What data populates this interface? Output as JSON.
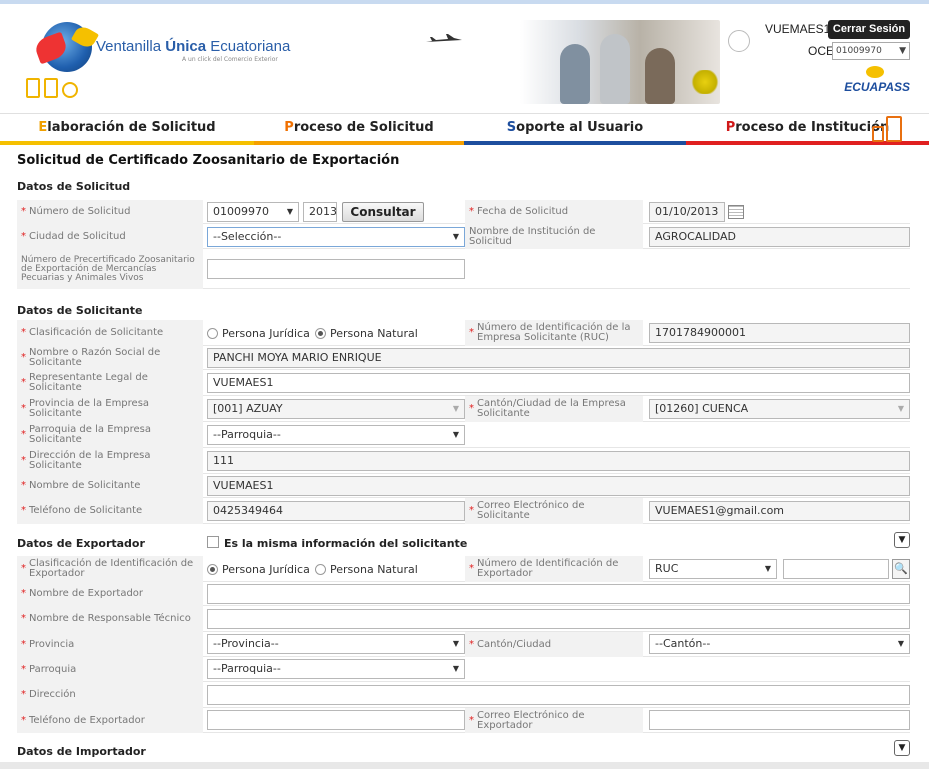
{
  "header": {
    "logo_text_plain": "Ventanilla ",
    "logo_text_bold": "Única",
    "logo_text_end": " Ecuatoriana",
    "logo_subtitle": "A un click del Comercio Exterior",
    "user_name": "VUEMAES1",
    "logout_label": "Cerrar Sesión",
    "oce_label": "OCE",
    "oce_value": "01009970",
    "brand": "ECUAPASS"
  },
  "nav": [
    {
      "first": "E",
      "rest": "laboración de Solicitud"
    },
    {
      "first": "P",
      "rest": "roceso de Solicitud"
    },
    {
      "first": "S",
      "rest": "oporte al Usuario"
    },
    {
      "first": "P",
      "rest": "roceso de Institución"
    }
  ],
  "page_title": "Solicitud de Certificado Zoosanitario de Exportación",
  "datos_solicitud": {
    "title": "Datos de Solicitud",
    "numero_label": "Número de Solicitud",
    "numero_value": "01009970",
    "numero_year": "2013",
    "consultar_label": "Consultar",
    "fecha_label": "Fecha de Solicitud",
    "fecha_value": "01/10/2013",
    "ciudad_label": "Ciudad de Solicitud",
    "ciudad_value": "--Selección--",
    "institucion_label": "Nombre de Institución de Solicitud",
    "institucion_value": "AGROCALIDAD",
    "precert_label": "Número de Precertificado Zoosanitario de Exportación de Mercancías Pecuarias y Animales Vivos",
    "precert_value": ""
  },
  "datos_solicitante": {
    "title": "Datos de Solicitante",
    "clasificacion_label": "Clasificación de Solicitante",
    "radio_juridica": "Persona Jurídica",
    "radio_natural": "Persona Natural",
    "ruc_label": "Número de Identificación de la Empresa Solicitante (RUC)",
    "ruc_value": "1701784900001",
    "razon_label": "Nombre o Razón Social de Solicitante",
    "razon_value": "PANCHI MOYA MARIO ENRIQUE",
    "representante_label": "Representante Legal de Solicitante",
    "representante_value": "VUEMAES1",
    "provincia_label": "Provincia de la Empresa Solicitante",
    "provincia_value": "[001] AZUAY",
    "canton_label": "Cantón/Ciudad de la Empresa Solicitante",
    "canton_value": "[01260] CUENCA",
    "parroquia_label": "Parroquia de la Empresa Solicitante",
    "parroquia_value": "--Parroquia--",
    "direccion_label": "Dirección de la Empresa Solicitante",
    "direccion_value": "111",
    "nombre_label": "Nombre de Solicitante",
    "nombre_value": "VUEMAES1",
    "telefono_label": "Teléfono de Solicitante",
    "telefono_value": "0425349464",
    "correo_label": "Correo Electrónico de Solicitante",
    "correo_value": "VUEMAES1@gmail.com"
  },
  "datos_exportador": {
    "title": "Datos de Exportador",
    "same_info_label": "Es la misma información del solicitante",
    "clasificacion_label": "Clasificación de Identificación de Exportador",
    "radio_juridica": "Persona Jurídica",
    "radio_natural": "Persona Natural",
    "num_id_label": "Número de Identificación de Exportador",
    "num_id_type": "RUC",
    "num_id_value": "",
    "nombre_label": "Nombre de Exportador",
    "responsable_label": "Nombre de Responsable Técnico",
    "provincia_label": "Provincia",
    "provincia_value": "--Provincia--",
    "canton_label": "Cantón/Ciudad",
    "canton_value": "--Cantón--",
    "parroquia_label": "Parroquia",
    "parroquia_value": "--Parroquia--",
    "direccion_label": "Dirección",
    "telefono_label": "Teléfono de Exportador",
    "correo_label": "Correo Electrónico de Exportador"
  },
  "datos_importador": {
    "title": "Datos de Importador"
  },
  "colors": {
    "required": "#e02020",
    "label_bg": "#f2f2f2",
    "nav_yellow": "#f5c000",
    "nav_orange": "#f5a000",
    "nav_blue": "#1d4e9e",
    "nav_red": "#e02020"
  },
  "icons": {
    "collapse": "chevron-down-icon",
    "search": "magnifier-icon",
    "calendar": "calendar-icon"
  }
}
